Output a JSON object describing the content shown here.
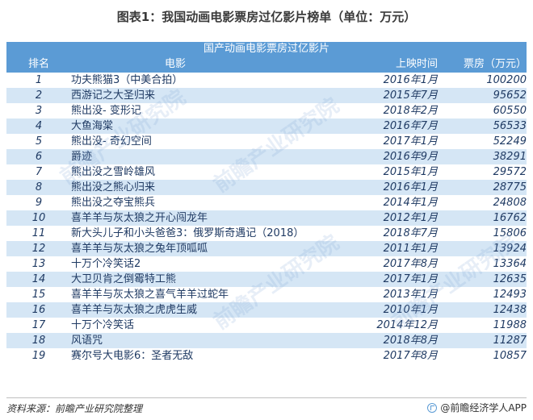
{
  "title": "图表1：我国动画电影票房过亿影片榜单（单位：万元）",
  "table": {
    "caption": "国产动画电影票房过亿影片",
    "headers": {
      "rank": "排名",
      "film": "电影",
      "date": "上映时间",
      "box": "票房（万元）"
    },
    "rows": [
      {
        "rank": "1",
        "film": "功夫熊猫3（中美合拍）",
        "date": "2016年1月",
        "box": "100200"
      },
      {
        "rank": "2",
        "film": "西游记之大圣归来",
        "date": "2015年7月",
        "box": "95652"
      },
      {
        "rank": "3",
        "film": "熊出没- 变形记",
        "date": "2018年2月",
        "box": "60550"
      },
      {
        "rank": "4",
        "film": "大鱼海棠",
        "date": "2016年7月",
        "box": "56533"
      },
      {
        "rank": "5",
        "film": "熊出没- 奇幻空间",
        "date": "2017年1月",
        "box": "52249"
      },
      {
        "rank": "6",
        "film": "爵迹",
        "date": "2016年9月",
        "box": "38291"
      },
      {
        "rank": "7",
        "film": "熊出没之雪岭雄风",
        "date": "2015年1月",
        "box": "29572"
      },
      {
        "rank": "8",
        "film": "熊出没之熊心归来",
        "date": "2016年1月",
        "box": "28775"
      },
      {
        "rank": "9",
        "film": "熊出没之夺宝熊兵",
        "date": "2014年1月",
        "box": "24808"
      },
      {
        "rank": "10",
        "film": "喜羊羊与灰太狼之开心闯龙年",
        "date": "2012年1月",
        "box": "16762"
      },
      {
        "rank": "11",
        "film": "新大头儿子和小头爸爸3：俄罗斯奇遇记（2018）",
        "date": "2018年7月",
        "box": "15806"
      },
      {
        "rank": "12",
        "film": "喜羊羊与灰太狼之兔年顶呱呱",
        "date": "2011年1月",
        "box": "13924"
      },
      {
        "rank": "13",
        "film": "十万个冷笑话2",
        "date": "2017年8月",
        "box": "13364"
      },
      {
        "rank": "14",
        "film": "大卫贝肯之倒霉特工熊",
        "date": "2017年1月",
        "box": "12635"
      },
      {
        "rank": "15",
        "film": "喜羊羊与灰太狼之喜气羊羊过蛇年",
        "date": "2013年1月",
        "box": "12493"
      },
      {
        "rank": "16",
        "film": "喜羊羊与灰太狼之虎虎生威",
        "date": "2010年1月",
        "box": "12438"
      },
      {
        "rank": "17",
        "film": "十万个冷笑话",
        "date": "2014年12月",
        "box": "11988"
      },
      {
        "rank": "18",
        "film": "风语咒",
        "date": "2018年8月",
        "box": "11287"
      },
      {
        "rank": "19",
        "film": "赛尔号大电影6：圣者无敌",
        "date": "2017年8月",
        "box": "10857"
      }
    ]
  },
  "footer": {
    "source": "资料来源：前瞻产业研究院整理",
    "brand": "@前瞻经济学人APP"
  },
  "watermark": "前瞻产业研究院",
  "colors": {
    "header_bg": "#5b9bd5",
    "stripe_bg": "#d5e6f5",
    "text": "#1f3a63"
  }
}
